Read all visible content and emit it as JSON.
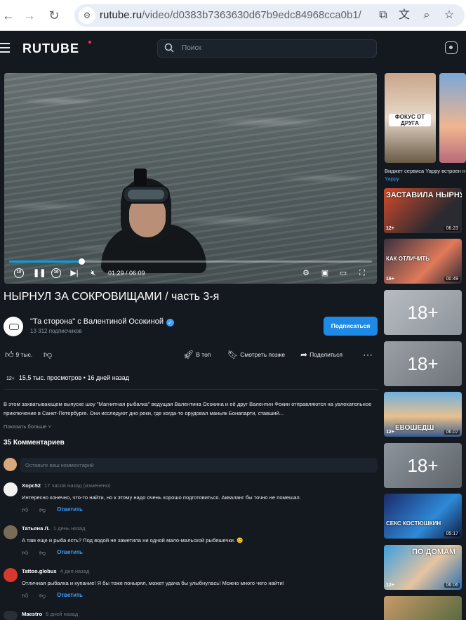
{
  "browser": {
    "url_host": "rutube.ru",
    "url_path": "/video/d0383b7363630d67b9edc84968cca0b1/"
  },
  "header": {
    "logo": "RUTUBE",
    "search_placeholder": "Поиск"
  },
  "player": {
    "progress": 0.2,
    "timecode": "01:29 / 06:09",
    "skip_back": "10",
    "skip_forward": "10"
  },
  "video": {
    "title": "НЫРНУЛ ЗА СОКРОВИЩАМИ / часть 3-я",
    "channel_name": "\"Та сторона\" с Валентиной Осокиной",
    "subscribers": "13 312 подписчиков",
    "subscribe_label": "Подписаться",
    "likes": "9 тыс.",
    "actions": {
      "top": "В топ",
      "watch_later": "Смотреть позже",
      "share": "Поделиться"
    },
    "age_rating": "12+",
    "views": "15,5 тыс. просмотров",
    "published": "16 дней назад",
    "description": "В этом захватывающем выпуске шоу \"Магнитная рыбалка\" ведущая Валентина Осокина и её друг Валентин Фокин отправляются на увлекательное приключение в Санкт-Петербурге. Они исследуют дно реки, где когда-то орудовал маньяк Бонапарти, ставший...",
    "show_more": "Показать больше"
  },
  "comments": {
    "heading": "35 Комментариев",
    "input_placeholder": "Оставьте ваш комментарий",
    "reply_label": "Ответить",
    "items": [
      {
        "author": "Xopc52",
        "when": "17 часов назад (изменено)",
        "text": "Интересно конечно, что-то найти, но к этому надо очень хорошо подготовиться. Акваланг бы точно не помешал."
      },
      {
        "author": "Татьяна Л.",
        "when": "1 день назад",
        "text": "А там еще и рыба есть? Под водой не заметила ни одной мало-мальской рыбешечки. 😊"
      },
      {
        "author": "Tattoo.globus",
        "when": "4 дня назад",
        "text": "Отличная рыбалка и купание! Я бы тоже понырял, может удача бы улыбнулась! Можно много чего найти!"
      },
      {
        "author": "Maestro",
        "when": "6 дней назад",
        "text": ""
      }
    ]
  },
  "sidebar": {
    "shorts_caption": "ФОКУС ОТ ДРУГА",
    "widget_text": "Виджет сервиса Yappy встроен н",
    "widget_link": "Yappy",
    "items": [
      {
        "banner": "ЗАСТАВИЛА НЫРНУТЬ",
        "age": "12+",
        "duration": "06:23"
      },
      {
        "banner": "КАК ОТЛИЧИТЬ",
        "age": "16+",
        "duration": "00:49"
      },
      {
        "banner": "18+",
        "age": "",
        "duration": ""
      },
      {
        "banner": "18+",
        "age": "",
        "duration": ""
      },
      {
        "banner": "ЕВОШЕДШ",
        "age": "12+",
        "duration": "06:07"
      },
      {
        "banner": "18+",
        "age": "",
        "duration": ""
      },
      {
        "banner": "СЕКС КОСТЮШКИН",
        "age": "",
        "duration": "05:17"
      },
      {
        "banner": "ПО ДОМАМ",
        "age": "12+",
        "duration": "06:06"
      },
      {
        "banner": "",
        "age": "",
        "duration": ""
      }
    ]
  }
}
